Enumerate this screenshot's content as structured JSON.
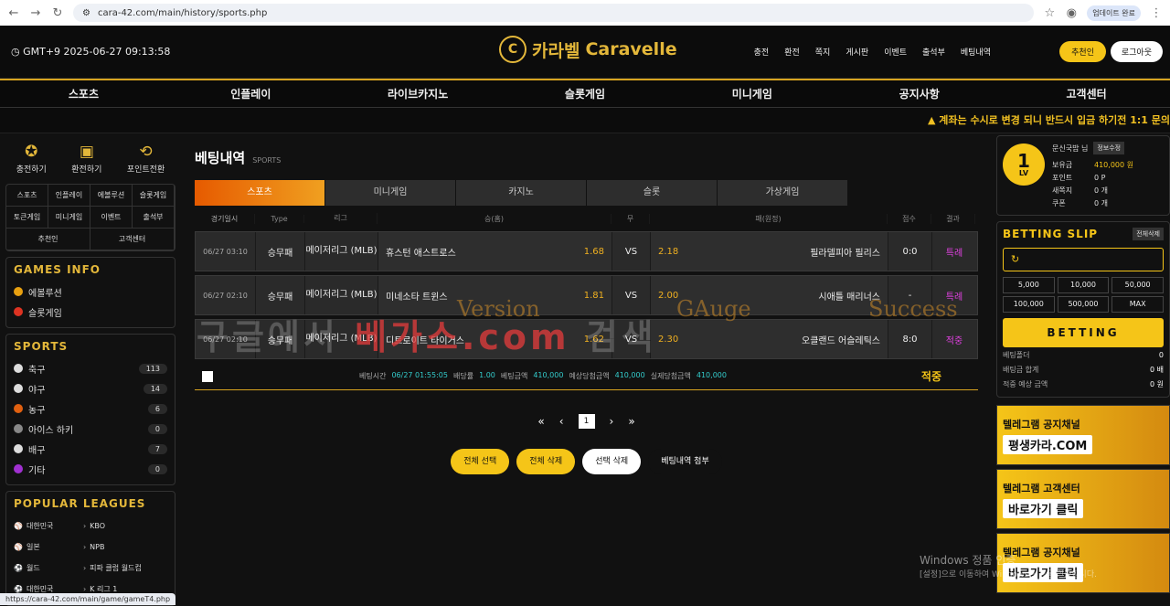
{
  "browser": {
    "url": "cara-42.com/main/history/sports.php",
    "update_btn": "업데이트 완료"
  },
  "top": {
    "clock": "GMT+9 2025-06-27 09:13:58",
    "logo_ko": "카라벨",
    "logo_en": "Caravelle",
    "menu": [
      "충전",
      "환전",
      "쪽지",
      "게시판",
      "이벤트",
      "출석부",
      "베팅내역"
    ],
    "refer_btn": "추천인",
    "logout_btn": "로그아웃"
  },
  "nav": [
    "스포츠",
    "인플레이",
    "라이브카지노",
    "슬롯게임",
    "미니게임",
    "공지사항",
    "고객센터"
  ],
  "ticker": "▲ 계좌는 수시로 변경 되니 반드시 입금 하기전 1:1 문의",
  "left": {
    "quick": [
      {
        "icon": "✪",
        "label": "충전하기"
      },
      {
        "icon": "▣",
        "label": "환전하기"
      },
      {
        "icon": "⟲",
        "label": "포인트전환"
      }
    ],
    "grid": [
      "스포츠",
      "인플레이",
      "에볼루션",
      "슬롯게임",
      "토큰게임",
      "미니게임",
      "이벤트",
      "출석부",
      "추천인",
      "고객센터"
    ],
    "games_title": "GAMES INFO",
    "games": [
      {
        "label": "에볼루션",
        "color": "#e8a010"
      },
      {
        "label": "슬롯게임",
        "color": "#d32"
      }
    ],
    "sports_title": "SPORTS",
    "sports": [
      {
        "label": "축구",
        "count": "113",
        "color": "#ddd"
      },
      {
        "label": "야구",
        "count": "14",
        "color": "#ddd"
      },
      {
        "label": "농구",
        "count": "6",
        "color": "#e06010"
      },
      {
        "label": "아이스 하키",
        "count": "0",
        "color": "#888"
      },
      {
        "label": "배구",
        "count": "7",
        "color": "#ddd"
      },
      {
        "label": "기타",
        "count": "0",
        "color": "#a030d0"
      }
    ],
    "leagues_title": "POPULAR LEAGUES",
    "leagues": [
      {
        "name": "대한민국",
        "league": "KBO"
      },
      {
        "name": "일본",
        "league": "NPB"
      },
      {
        "name": "월드",
        "league": "피파 클럽 월드컵"
      },
      {
        "name": "대한민국",
        "league": "K 리그 1"
      }
    ]
  },
  "center": {
    "title": "베팅내역",
    "subtitle": "SPORTS",
    "tabs": [
      "스포츠",
      "미니게임",
      "카지노",
      "슬롯",
      "가상게임"
    ],
    "headers": [
      "경기일시",
      "Type",
      "리그",
      "승(홈)",
      "무",
      "패(원정)",
      "점수",
      "결과"
    ],
    "rows": [
      {
        "date": "06/27 03:10",
        "type": "승무패",
        "league": "메이저리그 (MLB)",
        "home": "휴스턴 애스트로스",
        "home_odds": "1.68",
        "vs": "VS",
        "away_odds": "2.18",
        "away": "필라델피아 필리스",
        "score": "0:0",
        "result": "특례"
      },
      {
        "date": "06/27 02:10",
        "type": "승무패",
        "league": "메이저리그 (MLB)",
        "home": "미네소타 트윈스",
        "home_odds": "1.81",
        "vs": "VS",
        "away_odds": "2.00",
        "away": "시애틀 매리너스",
        "score": "-",
        "result": "특례"
      },
      {
        "date": "06/27 02:10",
        "type": "승무패",
        "league": "메이저리그 (MLB)",
        "home": "디트로이트 타이거스",
        "home_odds": "1.62",
        "vs": "VS",
        "away_odds": "2.30",
        "away": "오클랜드 어슬레틱스",
        "score": "8:0",
        "result": "적중"
      }
    ],
    "summary": {
      "bet_time_label": "베팅시간",
      "bet_time": "06/27 01:55:05",
      "odds_label": "배당률",
      "odds": "1.00",
      "amount_label": "베팅금액",
      "amount": "410,000",
      "expected_label": "예상당첨금액",
      "expected": "410,000",
      "actual_label": "실제당첨금액",
      "actual": "410,000",
      "result": "적중"
    },
    "page": "1",
    "actions": [
      "전체 선택",
      "전체 삭제",
      "선택 삭제",
      "베팅내역 첨부"
    ]
  },
  "right": {
    "level": "1",
    "lv": "LV",
    "user": "문신국밥 님",
    "edit": "정보수정",
    "info": [
      {
        "k": "보유금",
        "v": "410,000 원"
      },
      {
        "k": "포인트",
        "v": "0 P"
      },
      {
        "k": "새쪽지",
        "v": "0 개"
      },
      {
        "k": "쿠폰",
        "v": "0 개"
      }
    ],
    "slip_title": "BETTING SLIP",
    "clear": "전체삭제",
    "amounts": [
      "5,000",
      "10,000",
      "50,000",
      "100,000",
      "500,000",
      "MAX"
    ],
    "bet_btn": "BETTING",
    "stats": [
      {
        "k": "베팅폴더",
        "v": "0"
      },
      {
        "k": "배팅금 합계",
        "v": "0 배"
      },
      {
        "k": "적중 예상 금액",
        "v": "0 원"
      }
    ],
    "banners": [
      {
        "t1": "텔레그램 공지채널",
        "t2": "평생카라.COM"
      },
      {
        "t1": "텔레그램 고객센터",
        "t2": "바로가기 클릭"
      },
      {
        "t1": "텔레그램 공지채널",
        "t2": "바로가기 클릭"
      }
    ]
  },
  "watermark": {
    "main": "구글에서 ",
    "red": "베가스.com",
    "end": " 검색",
    "version": "Version",
    "gauge": "GAuge",
    "success": "Success"
  },
  "windows": {
    "t1": "Windows 정품 인증",
    "t2": "[설정]으로 이동하여 Windows를 정품 인증합니다."
  },
  "statusbar": "https://cara-42.com/main/game/gameT4.php"
}
